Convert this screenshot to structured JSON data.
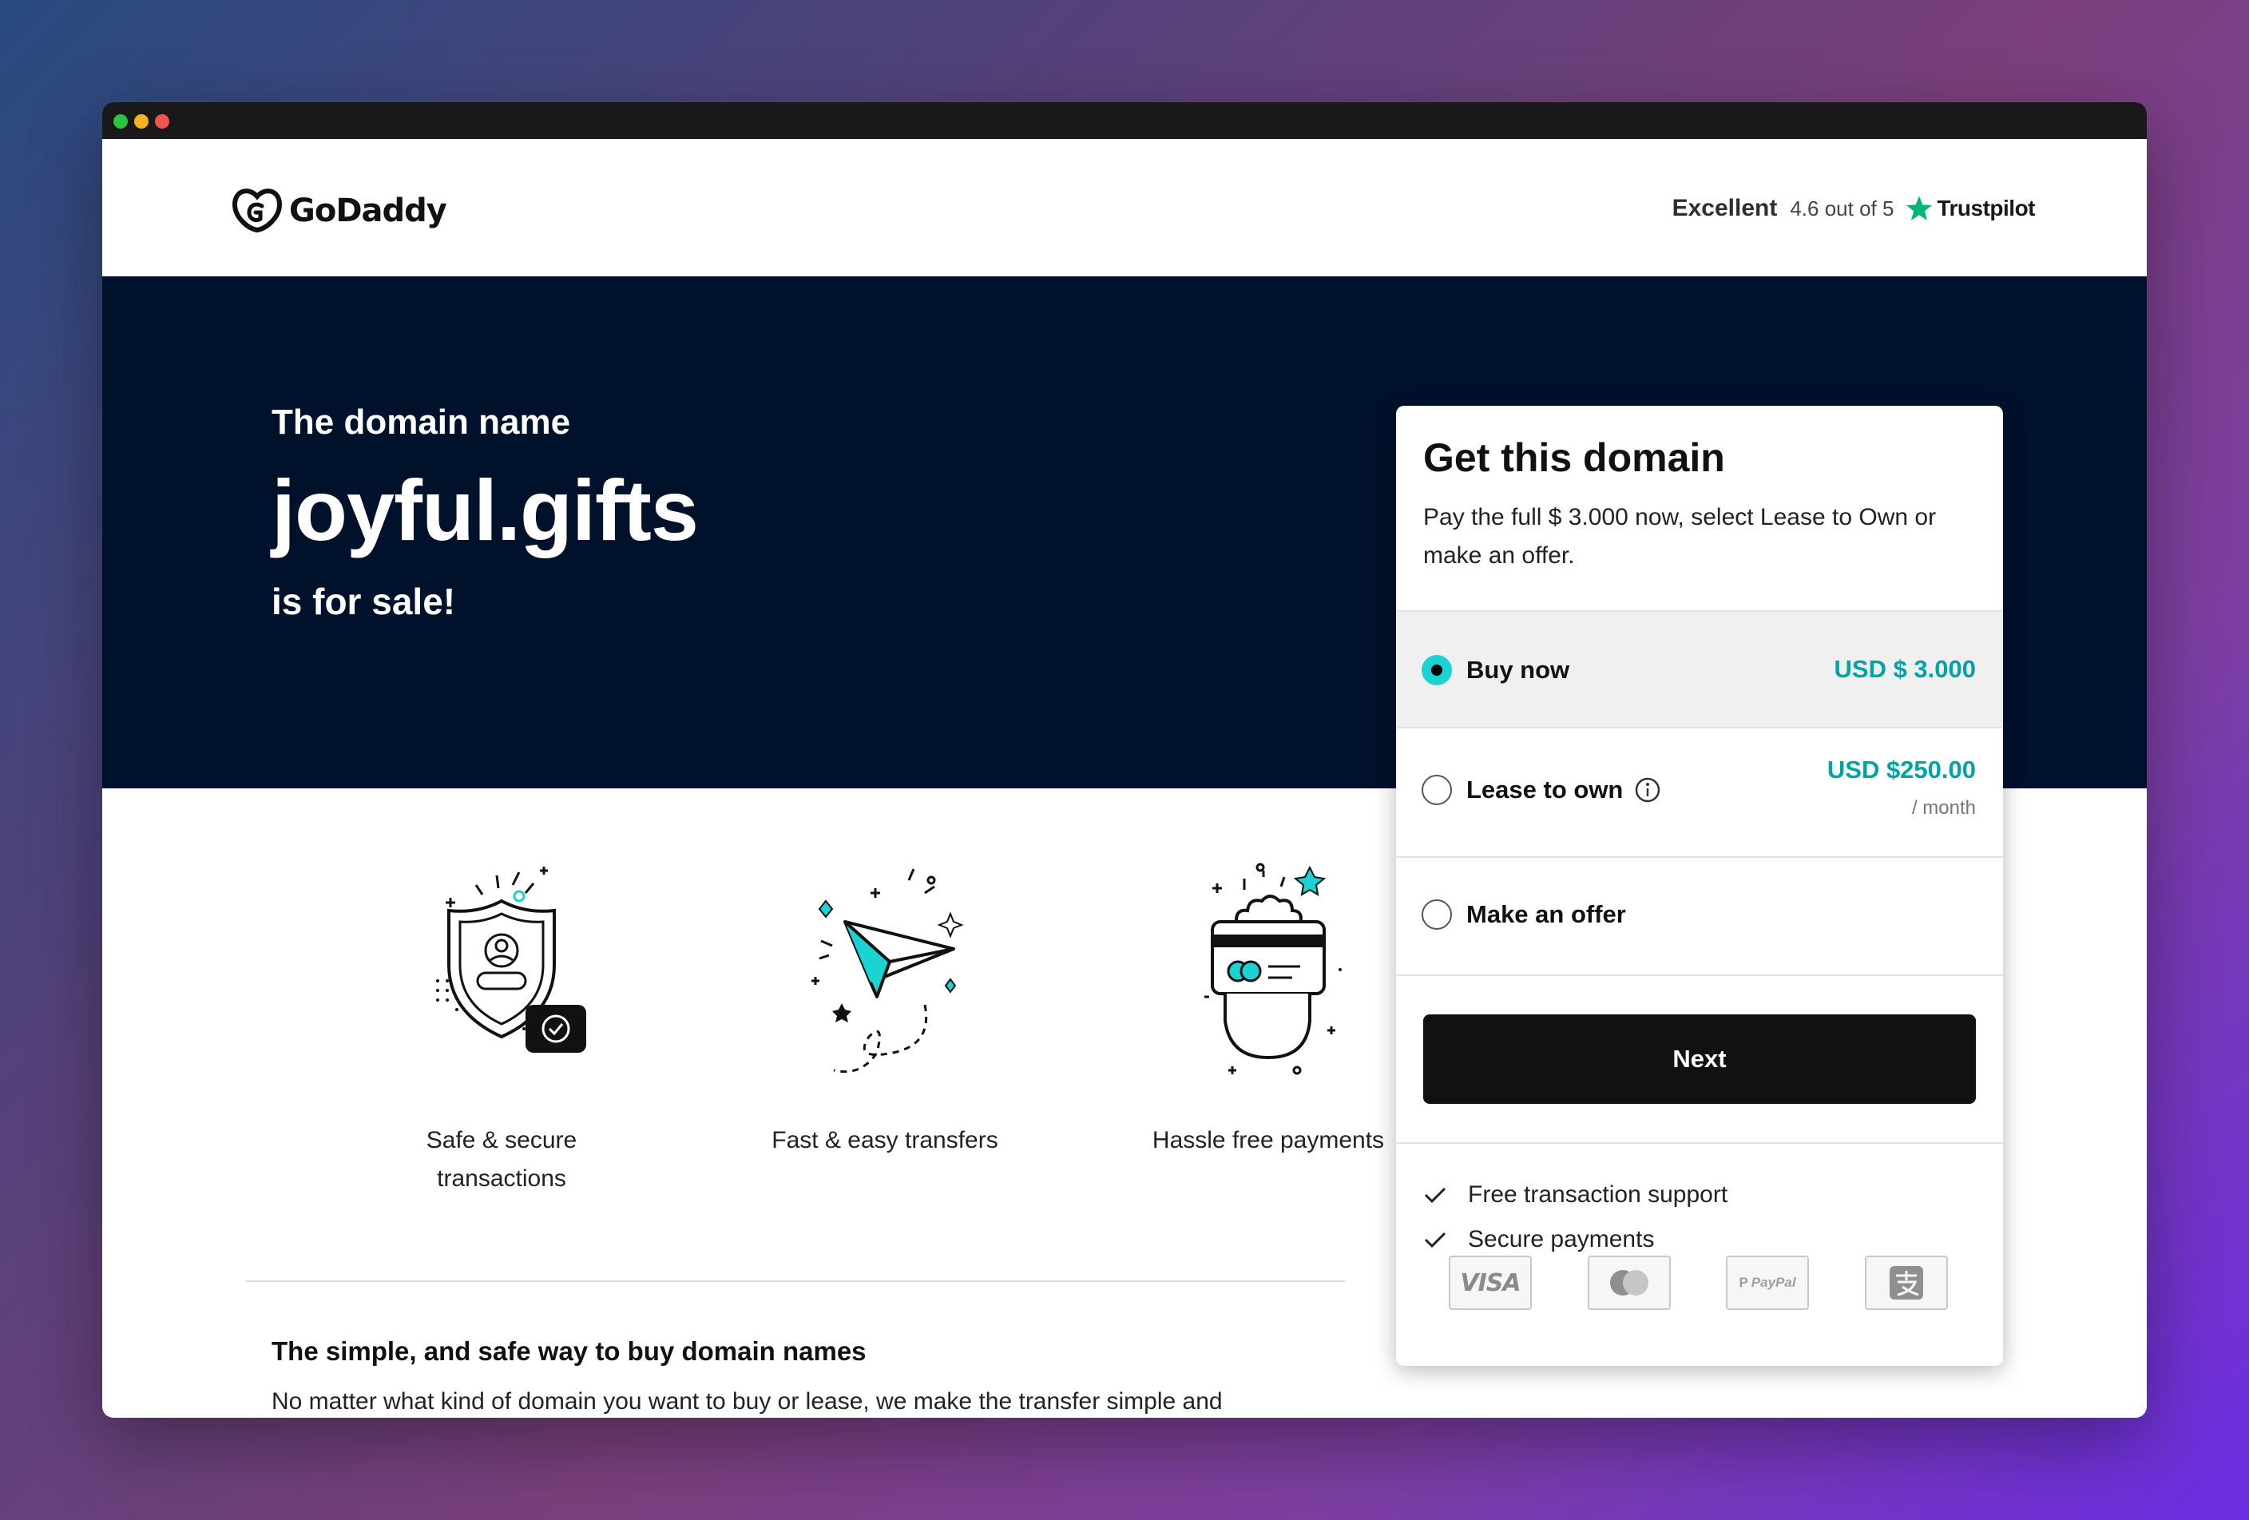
{
  "header": {
    "logo_text": "GoDaddy",
    "trustpilot": {
      "rating_word": "Excellent",
      "score_text": "4.6 out of 5",
      "brand": "Trustpilot"
    }
  },
  "hero": {
    "pre": "The domain name",
    "domain": "joyful.gifts",
    "post": "is for sale!"
  },
  "features": [
    {
      "label_line1": "Safe & secure",
      "label_line2": "transactions",
      "icon": "shield-icon"
    },
    {
      "label_line1": "Fast & easy transfers",
      "label_line2": "",
      "icon": "paper-plane-icon"
    },
    {
      "label_line1": "Hassle free payments",
      "label_line2": "",
      "icon": "card-hand-icon"
    }
  ],
  "info": {
    "title": "The simple, and safe way to buy domain names",
    "body": "No matter what kind of domain you want to buy or lease, we make the transfer simple and"
  },
  "card": {
    "title": "Get this domain",
    "subtitle": "Pay the full $ 3.000 now, select Lease to Own or make an offer.",
    "options": [
      {
        "label": "Buy now",
        "price": "USD $ 3.000",
        "selected": true
      },
      {
        "label": "Lease to own",
        "price": "USD $250.00",
        "period": "/ month",
        "selected": false
      },
      {
        "label": "Make an offer",
        "selected": false
      }
    ],
    "next_label": "Next",
    "perks": [
      "Free transaction support",
      "Secure payments"
    ],
    "payment_methods": [
      "VISA",
      "mastercard-icon",
      "PayPal",
      "alipay-icon"
    ]
  },
  "colors": {
    "hero_bg": "#00112c",
    "accent": "#00a4a6",
    "radio_selected": "#1bd3d3",
    "trustpilot_green": "#00b67a"
  }
}
